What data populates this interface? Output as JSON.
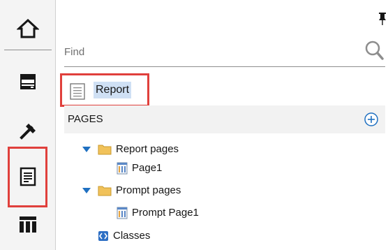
{
  "search": {
    "placeholder": "Find"
  },
  "report": {
    "label": "Report"
  },
  "pages_section": {
    "label": "PAGES"
  },
  "tree": {
    "report_pages": {
      "label": "Report pages",
      "children": [
        {
          "label": "Page1"
        }
      ]
    },
    "prompt_pages": {
      "label": "Prompt pages",
      "children": [
        {
          "label": "Prompt Page1"
        }
      ]
    },
    "classes": {
      "label": "Classes"
    }
  },
  "icons": {
    "rail": [
      "home-icon",
      "data-icon",
      "toolbox-icon",
      "pages-icon",
      "templates-icon"
    ],
    "panel": [
      "pin-icon",
      "search-icon",
      "add-icon",
      "document-icon",
      "folder-icon",
      "page-icon",
      "classes-icon"
    ]
  },
  "colors": {
    "highlight_border": "#e0403c",
    "selection_bg": "#cfe0f4",
    "caret_blue": "#1f70c1",
    "folder": "#f1c25a",
    "section_bg": "#f2f2f2",
    "rail_bg": "#f4f4f4"
  }
}
